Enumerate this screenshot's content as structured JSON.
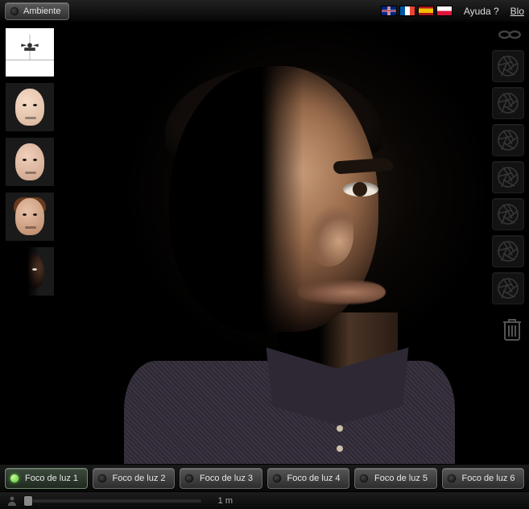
{
  "topbar": {
    "ambient_label": "Ambiente",
    "help_label": "Ayuda ?",
    "blog_label": "Blo",
    "flags": [
      "uk",
      "fr",
      "es",
      "pl"
    ]
  },
  "thumbnails": [
    {
      "kind": "diagram"
    },
    {
      "kind": "face",
      "skin": "skin1"
    },
    {
      "kind": "face",
      "skin": "skin2"
    },
    {
      "kind": "face",
      "skin": "skin3",
      "hair": true
    },
    {
      "kind": "face",
      "skin": "skin4",
      "dark": true
    }
  ],
  "aperture_count": 7,
  "lights": [
    {
      "label": "Foco de luz 1",
      "on": true,
      "active": true
    },
    {
      "label": "Foco de luz 2",
      "on": false,
      "active": false
    },
    {
      "label": "Foco de luz 3",
      "on": false,
      "active": false
    },
    {
      "label": "Foco de luz 4",
      "on": false,
      "active": false
    },
    {
      "label": "Foco de luz 5",
      "on": false,
      "active": false
    },
    {
      "label": "Foco de luz 6",
      "on": false,
      "active": false
    }
  ],
  "footer": {
    "distance_label": "1 m"
  },
  "icons": {
    "chain": "link-icon",
    "trash": "trash-icon",
    "aperture": "aperture-icon",
    "person": "person-icon"
  }
}
